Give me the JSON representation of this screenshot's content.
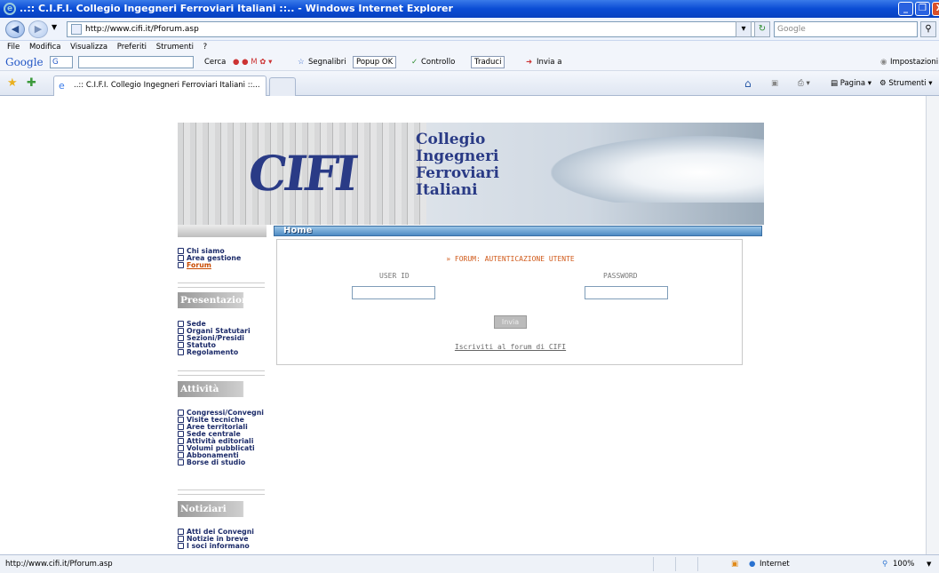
{
  "window": {
    "title": "..:: C.I.F.I. Collegio Ingegneri Ferroviari Italiani ::.. - Windows Internet Explorer",
    "controls": [
      "_",
      "❐",
      "X"
    ]
  },
  "address_bar": {
    "url": "http://www.cifi.it/Pforum.asp",
    "search_placeholder": "Google"
  },
  "menu": {
    "items": [
      "File",
      "Modifica",
      "Visualizza",
      "Preferiti",
      "Strumenti",
      "?"
    ]
  },
  "google_toolbar": {
    "logo": "Google",
    "g_btn": "G",
    "cerca": "Cerca",
    "segnalibri": "Segnalibri",
    "popup": "Popup OK",
    "controllo": "Controllo",
    "traduci": "Traduci",
    "invia": "Invia a",
    "impostazioni": "Impostazioni"
  },
  "tabs": {
    "active_label": "..:: C.I.F.I. Collegio Ingegneri Ferroviari Italiani ::...",
    "tools": {
      "pagina": "Pagina",
      "strumenti": "Strumenti"
    }
  },
  "site": {
    "logo_text": "CIFI",
    "org_lines": [
      "Collegio",
      "Ingegneri",
      "Ferroviari",
      "Italiani"
    ],
    "home_label": "Home",
    "top_links": [
      "Chi siamo",
      "Area gestione",
      "Forum"
    ],
    "sections": [
      {
        "title": "Presentazione",
        "links": [
          "Sede",
          "Organi Statutari",
          "Sezioni/Presidi",
          "Statuto",
          "Regolamento"
        ]
      },
      {
        "title": "Attività",
        "links": [
          "Congressi/Convegni",
          "Visite tecniche",
          "Aree territoriali",
          "Sede centrale",
          "Attività editoriali",
          "Volumi pubblicati",
          "Abbonamenti",
          "Borse di studio"
        ]
      },
      {
        "title": "Notiziari",
        "links": [
          "Atti dei Convegni",
          "Notizie in breve",
          "I soci informano"
        ]
      }
    ]
  },
  "form": {
    "title": "FORUM: AUTENTICAZIONE UTENTE",
    "user_label": "USER ID",
    "password_label": "PASSWORD",
    "submit_label": "Invia",
    "register_link": "Iscriviti al forum di CIFI"
  },
  "status_bar": {
    "url": "http://www.cifi.it/Pforum.asp",
    "zone": "Internet",
    "zoom": "100%"
  }
}
